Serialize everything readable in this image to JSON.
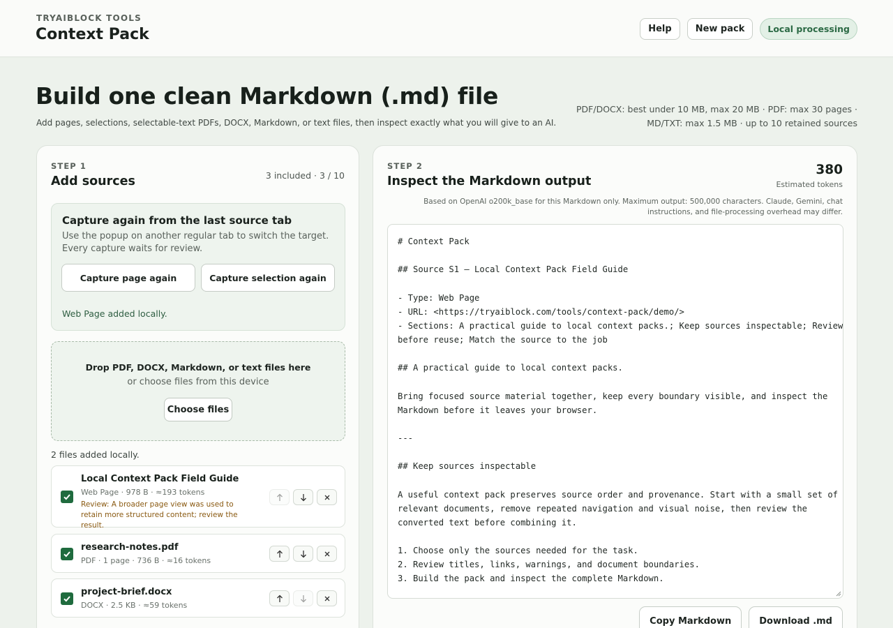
{
  "header": {
    "kicker": "TRYAIBLOCK TOOLS",
    "title": "Context Pack",
    "help_label": "Help",
    "new_pack_label": "New pack",
    "status_label": "Local processing"
  },
  "hero": {
    "title": "Build one clean Markdown (.md) file",
    "subtitle": "Add pages, selections, selectable-text PDFs, DOCX, Markdown, or text files, then inspect exactly what you will give to an AI.",
    "limits_line1": "PDF/DOCX: best under 10 MB, max 20 MB · PDF: max 30 pages ·",
    "limits_line2": "MD/TXT: max 1.5 MB · up to 10 retained sources"
  },
  "step1": {
    "label": "STEP 1",
    "title": "Add sources",
    "count": "3 included · 3 / 10",
    "capture": {
      "title": "Capture again from the last source tab",
      "description": "Use the popup on another regular tab to switch the target. Every capture waits for review.",
      "page_button": "Capture page again",
      "selection_button": "Capture selection again",
      "status": "Web Page added locally."
    },
    "dropzone": {
      "title": "Drop PDF, DOCX, Markdown, or text files here",
      "subtitle": "or choose files from this device",
      "choose_button": "Choose files"
    },
    "files_status": "2 files added locally.",
    "sources": [
      {
        "name": "Local Context Pack Field Guide",
        "meta": "Web Page · 978 B · ≈193 tokens",
        "warning": "Review: A broader page view was used to retain more structured content; review the result.",
        "checked": true
      },
      {
        "name": "research-notes.pdf",
        "meta": "PDF · 1 page · 736 B · ≈16 tokens",
        "warning": "",
        "checked": true
      },
      {
        "name": "project-brief.docx",
        "meta": "DOCX · 2.5 KB · ≈59 tokens",
        "warning": "",
        "checked": true
      }
    ]
  },
  "step2": {
    "label": "STEP 2",
    "title": "Inspect the Markdown output",
    "token_count": "380",
    "token_label": "Estimated tokens",
    "token_note": "Based on OpenAI o200k_base for this Markdown only. Maximum output: 500,000 characters. Claude, Gemini, chat instructions, and file-processing overhead may differ.",
    "markdown_lines": [
      "# Context Pack",
      "",
      "## Source S1 — Local Context Pack Field Guide",
      "",
      "- Type: Web Page",
      "- URL: <https://tryaiblock.com/tools/context-pack/demo/>",
      "- Sections: A practical guide to local context packs.; Keep sources inspectable; Review",
      "before reuse; Match the source to the job",
      "",
      "## A practical guide to local context packs.",
      "",
      "Bring focused source material together, keep every boundary visible, and inspect the",
      "Markdown before it leaves your browser.",
      "",
      "---",
      "",
      "## Keep sources inspectable",
      "",
      "A useful context pack preserves source order and provenance. Start with a small set of",
      "relevant documents, remove repeated navigation and visual noise, then review the",
      "converted text before combining it.",
      "",
      "1. Choose only the sources needed for the task.",
      "2. Review titles, links, warnings, and document boundaries.",
      "3. Build the pack and inspect the complete Markdown."
    ],
    "copy_button": "Copy Markdown",
    "download_button": "Download .md"
  },
  "colors": {
    "accent": "#1f6b3e",
    "background": "#edf2ec",
    "warning": "#8a5a12"
  },
  "icons": {
    "up": "arrow-up-icon",
    "down": "arrow-down-icon",
    "remove": "close-icon",
    "check": "checkmark-icon"
  }
}
